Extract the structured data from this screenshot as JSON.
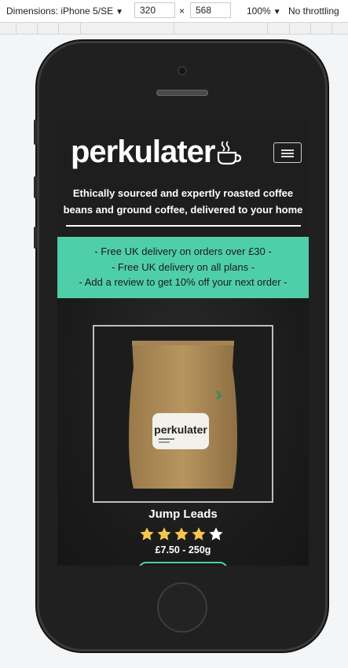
{
  "devtools": {
    "device": "Dimensions: iPhone 5/SE",
    "width": "320",
    "times": "×",
    "height": "568",
    "zoom": "100%",
    "throttle": "No throttling"
  },
  "site": {
    "brand": "perkulater",
    "tagline_line1": "Ethically sourced and expertly roasted coffee",
    "tagline_line2": "beans and ground coffee, delivered to your home",
    "promos": [
      "- Free UK delivery on orders over £30 -",
      "- Free UK delivery on all plans -",
      "- Add a review to get 10% off your next order -"
    ],
    "product": {
      "bag_label": "perkulater",
      "name": "Jump Leads",
      "rating": 4,
      "rating_max": 5,
      "price": "£7.50 - 250g"
    }
  },
  "colors": {
    "accent": "#4fcfa9",
    "star_filled": "#f5c84c",
    "star_empty": "#ffffff",
    "background": "#1e1e1e"
  }
}
